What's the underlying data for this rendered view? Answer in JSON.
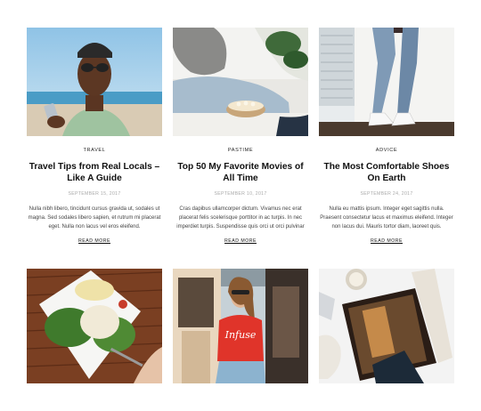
{
  "posts": [
    {
      "category": "Travel",
      "title": "Travel Tips from Real Locals – Like A Guide",
      "date": "September 15, 2017",
      "excerpt": "Nulla nibh libero, tincidunt cursus gravida ut, sodales ut magna. Sed sodales libero sapien, et rutrum mi placerat eget. Nulla non lacus vel eros eleifend.",
      "read_more": "Read More"
    },
    {
      "category": "Pastime",
      "title": "Top 50 My Favorite Movies of All Time",
      "date": "September 10, 2017",
      "excerpt": "Cras dapibus ullamcorper dictum. Vivamus nec erat placerat felis scelerisque porttitor in ac turpis. In nec imperdiet turpis. Suspendisse quis orci ut orci pulvinar",
      "read_more": "Read More"
    },
    {
      "category": "Advice",
      "title": "The Most Comfortable Shoes On Earth",
      "date": "September 24, 2017",
      "excerpt": "Nulla eu mattis ipsum. Integer eget sagittis nulla. Praesent consectetur lacus et maximus eleifend. Integer non lacus dui. Mauris tortor diam, laoreet quis.",
      "read_more": "Read More"
    }
  ],
  "images": {
    "photo_1": "man with sunglasses holding phone at the sea",
    "photo_2": "person sitting with bowl of popcorn",
    "photo_3": "legs in ripped jeans and white sneakers",
    "photo_4": "plate with salad and burrata",
    "photo_5": "woman in red t-shirt on street",
    "photo_6": "open magazine with candle and knit blanket"
  },
  "shirt_text": "Infuse"
}
